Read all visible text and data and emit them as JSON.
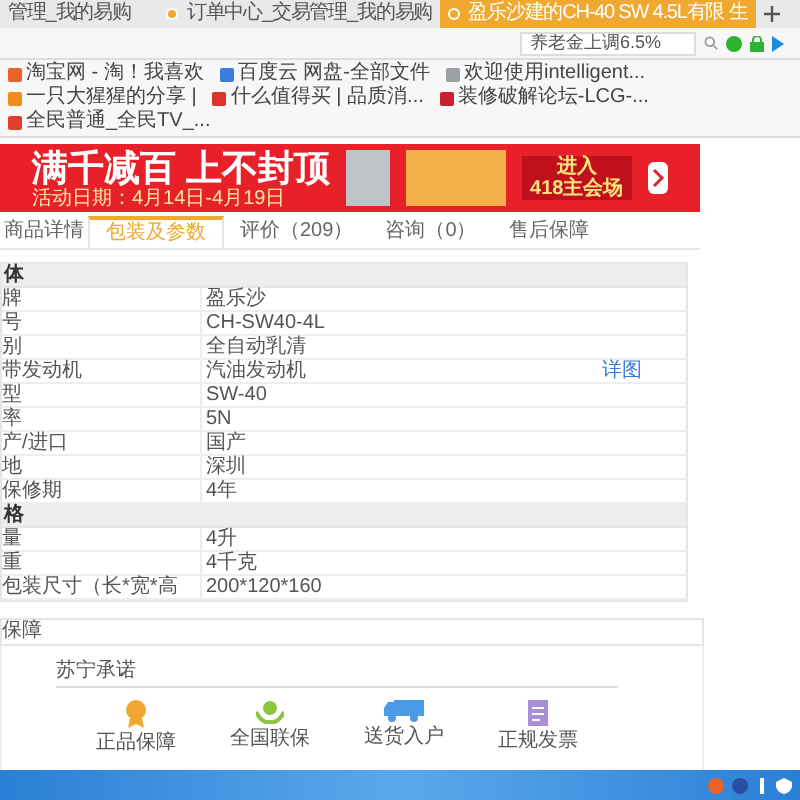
{
  "browser": {
    "tabs": [
      {
        "label": "管理_我的易购",
        "selected": false
      },
      {
        "label": "订单中心_交易管理_我的易购",
        "selected": false
      },
      {
        "label": "盈乐沙建的CH-40 SW 4.5L有限 生",
        "selected": true
      }
    ],
    "search": {
      "placeholder": "养老金上调6.5%"
    },
    "bookmarks": [
      {
        "label": "淘宝网 - 淘！我喜欢",
        "color": "#e8632a"
      },
      {
        "label": "百度云 网盘-全部文件",
        "color": "#3b7ddd"
      },
      {
        "label": "欢迎使用intelligent...",
        "color": "#9aa0a6"
      },
      {
        "label": "一只大猩猩的分享 |",
        "color": "#f08c1e"
      },
      {
        "label": "什么值得买 | 品质消...",
        "color": "#d9352b"
      },
      {
        "label": "装修破解论坛-LCG-...",
        "color": "#c8202f"
      },
      {
        "label": "全民普通_全民TV_...",
        "color": "#e0402a"
      }
    ]
  },
  "banner": {
    "headline": "满千减百 上不封顶",
    "dates": "活动日期：4月14日-4月19日",
    "cta_line1": "进入",
    "cta_line2": "418主会场"
  },
  "product_tabs": [
    {
      "label": "商品详情",
      "selected": false
    },
    {
      "label": "包装及参数",
      "selected": true
    },
    {
      "label": "评价（209）",
      "selected": false
    },
    {
      "label": "咨询（0）",
      "selected": false
    },
    {
      "label": "售后保障",
      "selected": false
    }
  ],
  "spec_table": [
    {
      "kind": "section",
      "label": "体"
    },
    {
      "kind": "row",
      "label": "牌",
      "value": "盈乐沙"
    },
    {
      "kind": "row",
      "label": "号",
      "value": "CH-SW40-4L"
    },
    {
      "kind": "row",
      "label": "别",
      "value": "全自动乳清"
    },
    {
      "kind": "row",
      "label": "带发动机",
      "value": "汽油发动机",
      "link": "详图"
    },
    {
      "kind": "row",
      "label": "型",
      "value": "SW-40"
    },
    {
      "kind": "row",
      "label": "率",
      "value": "5N"
    },
    {
      "kind": "row",
      "label": "产/进口",
      "value": "国产"
    },
    {
      "kind": "row",
      "label": "地",
      "value": "深圳"
    },
    {
      "kind": "row",
      "label": "保修期",
      "value": "4年"
    },
    {
      "kind": "section",
      "label": "格"
    },
    {
      "kind": "row",
      "label": "量",
      "value": "4升"
    },
    {
      "kind": "row",
      "label": "重",
      "value": "4千克"
    },
    {
      "kind": "row",
      "label": "包装尺寸（长*宽*高",
      "value": "200*120*160"
    }
  ],
  "after_sale": {
    "title": "保障"
  },
  "promise": {
    "title": "苏宁承诺",
    "items": [
      {
        "kind": "medal",
        "label": "正品保障"
      },
      {
        "kind": "hands",
        "label": "全国联保"
      },
      {
        "kind": "truck",
        "label": "送货入户"
      },
      {
        "kind": "invoice",
        "label": "正规发票"
      }
    ]
  }
}
